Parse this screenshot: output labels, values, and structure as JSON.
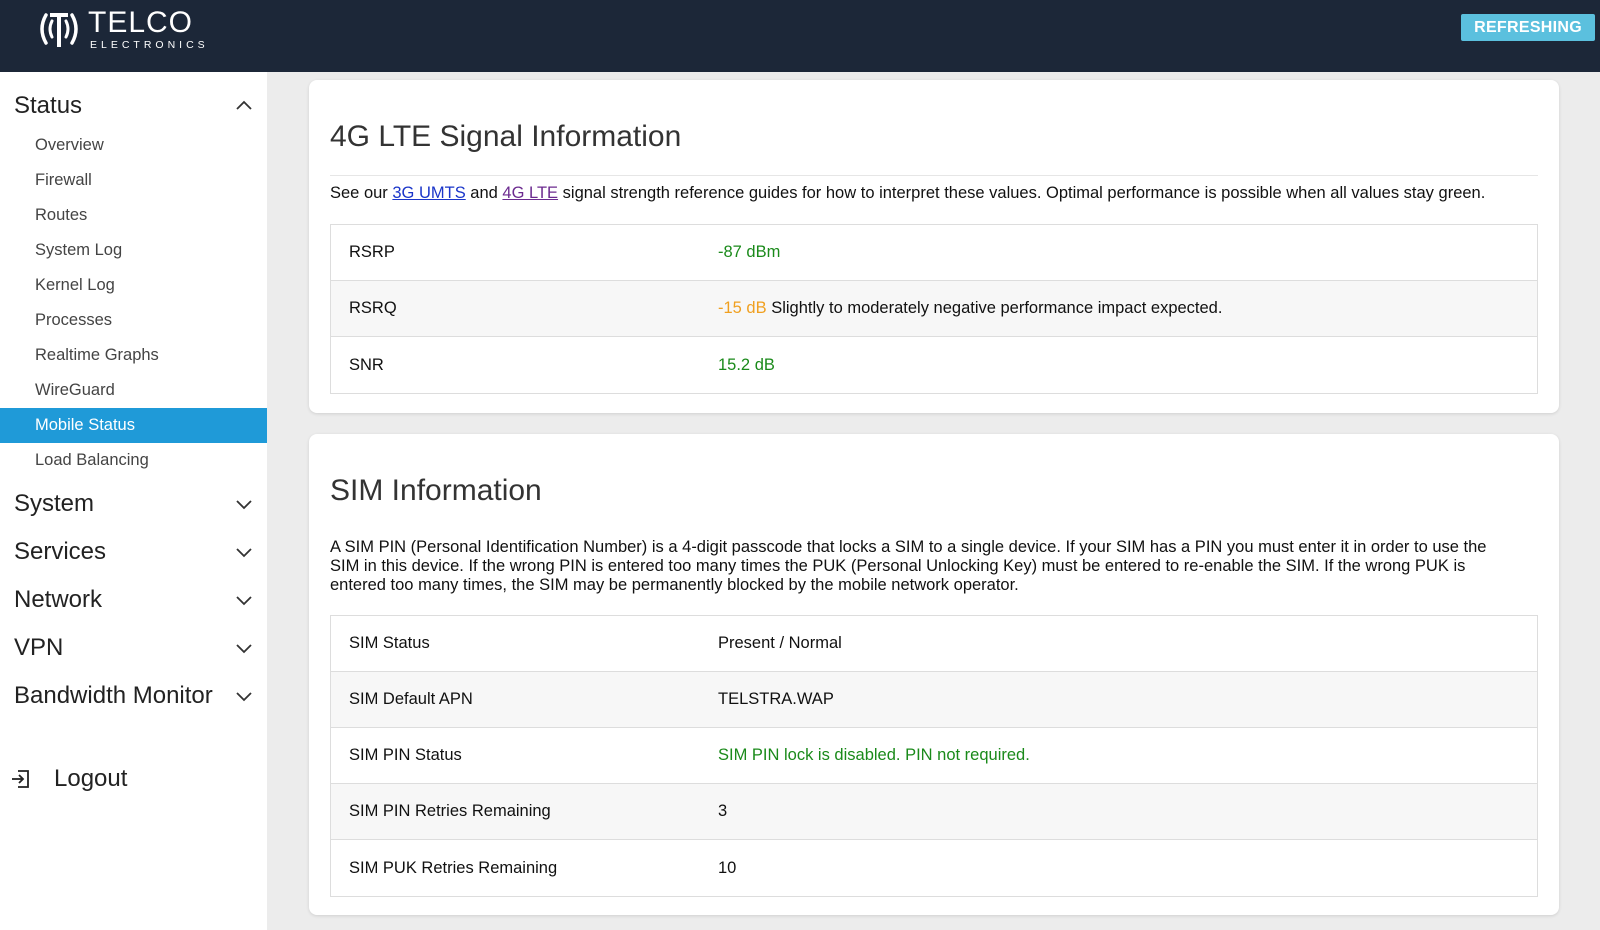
{
  "header": {
    "brand_main": "TELCO",
    "brand_sub": "ELECTRONICS",
    "status_badge": "REFRESHING",
    "logo_icon": "antenna-logo-icon"
  },
  "sidebar": {
    "groups": [
      {
        "label": "Status",
        "expanded": true,
        "icon": "chevron-up-icon"
      },
      {
        "label": "System",
        "expanded": false,
        "icon": "chevron-down-icon"
      },
      {
        "label": "Services",
        "expanded": false,
        "icon": "chevron-down-icon"
      },
      {
        "label": "Network",
        "expanded": false,
        "icon": "chevron-down-icon"
      },
      {
        "label": "VPN",
        "expanded": false,
        "icon": "chevron-down-icon"
      },
      {
        "label": "Bandwidth Monitor",
        "expanded": false,
        "icon": "chevron-down-icon"
      }
    ],
    "status_items": [
      {
        "label": "Overview"
      },
      {
        "label": "Firewall"
      },
      {
        "label": "Routes"
      },
      {
        "label": "System Log"
      },
      {
        "label": "Kernel Log"
      },
      {
        "label": "Processes"
      },
      {
        "label": "Realtime Graphs"
      },
      {
        "label": "WireGuard"
      },
      {
        "label": "Mobile Status",
        "active": true
      },
      {
        "label": "Load Balancing"
      }
    ],
    "logout": {
      "label": "Logout",
      "icon": "logout-icon"
    }
  },
  "lte": {
    "title": "4G LTE Signal Information",
    "desc_prefix": "See our ",
    "link_3g": "3G UMTS",
    "desc_and": " and ",
    "link_4g": "4G LTE",
    "desc_suffix": " signal strength reference guides for how to interpret these values. Optimal performance is possible when all values stay green.",
    "rows": [
      {
        "key": "RSRP",
        "value": "-87 dBm",
        "status": "good",
        "note": ""
      },
      {
        "key": "RSRQ",
        "value": "-15 dB",
        "status": "warning",
        "note": " Slightly to moderately negative performance impact expected."
      },
      {
        "key": "SNR",
        "value": "15.2 dB",
        "status": "good",
        "note": ""
      }
    ]
  },
  "sim": {
    "title": "SIM Information",
    "desc": "A SIM PIN (Personal Identification Number) is a 4-digit passcode that locks a SIM to a single device. If your SIM has a PIN you must enter it in order to use the SIM in this device. If the wrong PIN is entered too many times the PUK (Personal Unlocking Key) must be entered to re-enable the SIM. If the wrong PUK is entered too many times, the SIM may be permanently blocked by the mobile network operator.",
    "rows": [
      {
        "key": "SIM Status",
        "value": "Present / Normal",
        "status": "normal"
      },
      {
        "key": "SIM Default APN",
        "value": "TELSTRA.WAP",
        "status": "normal"
      },
      {
        "key": "SIM PIN Status",
        "value": "SIM PIN lock is disabled. PIN not required.",
        "status": "good"
      },
      {
        "key": "SIM PIN Retries Remaining",
        "value": "3",
        "status": "normal"
      },
      {
        "key": "SIM PUK Retries Remaining",
        "value": "10",
        "status": "normal"
      }
    ]
  },
  "colors": {
    "header_bg": "#1c2738",
    "accent": "#1f9ad8",
    "badge": "#5bc0de",
    "good": "#1a8a1a",
    "warning": "#f0a020"
  }
}
